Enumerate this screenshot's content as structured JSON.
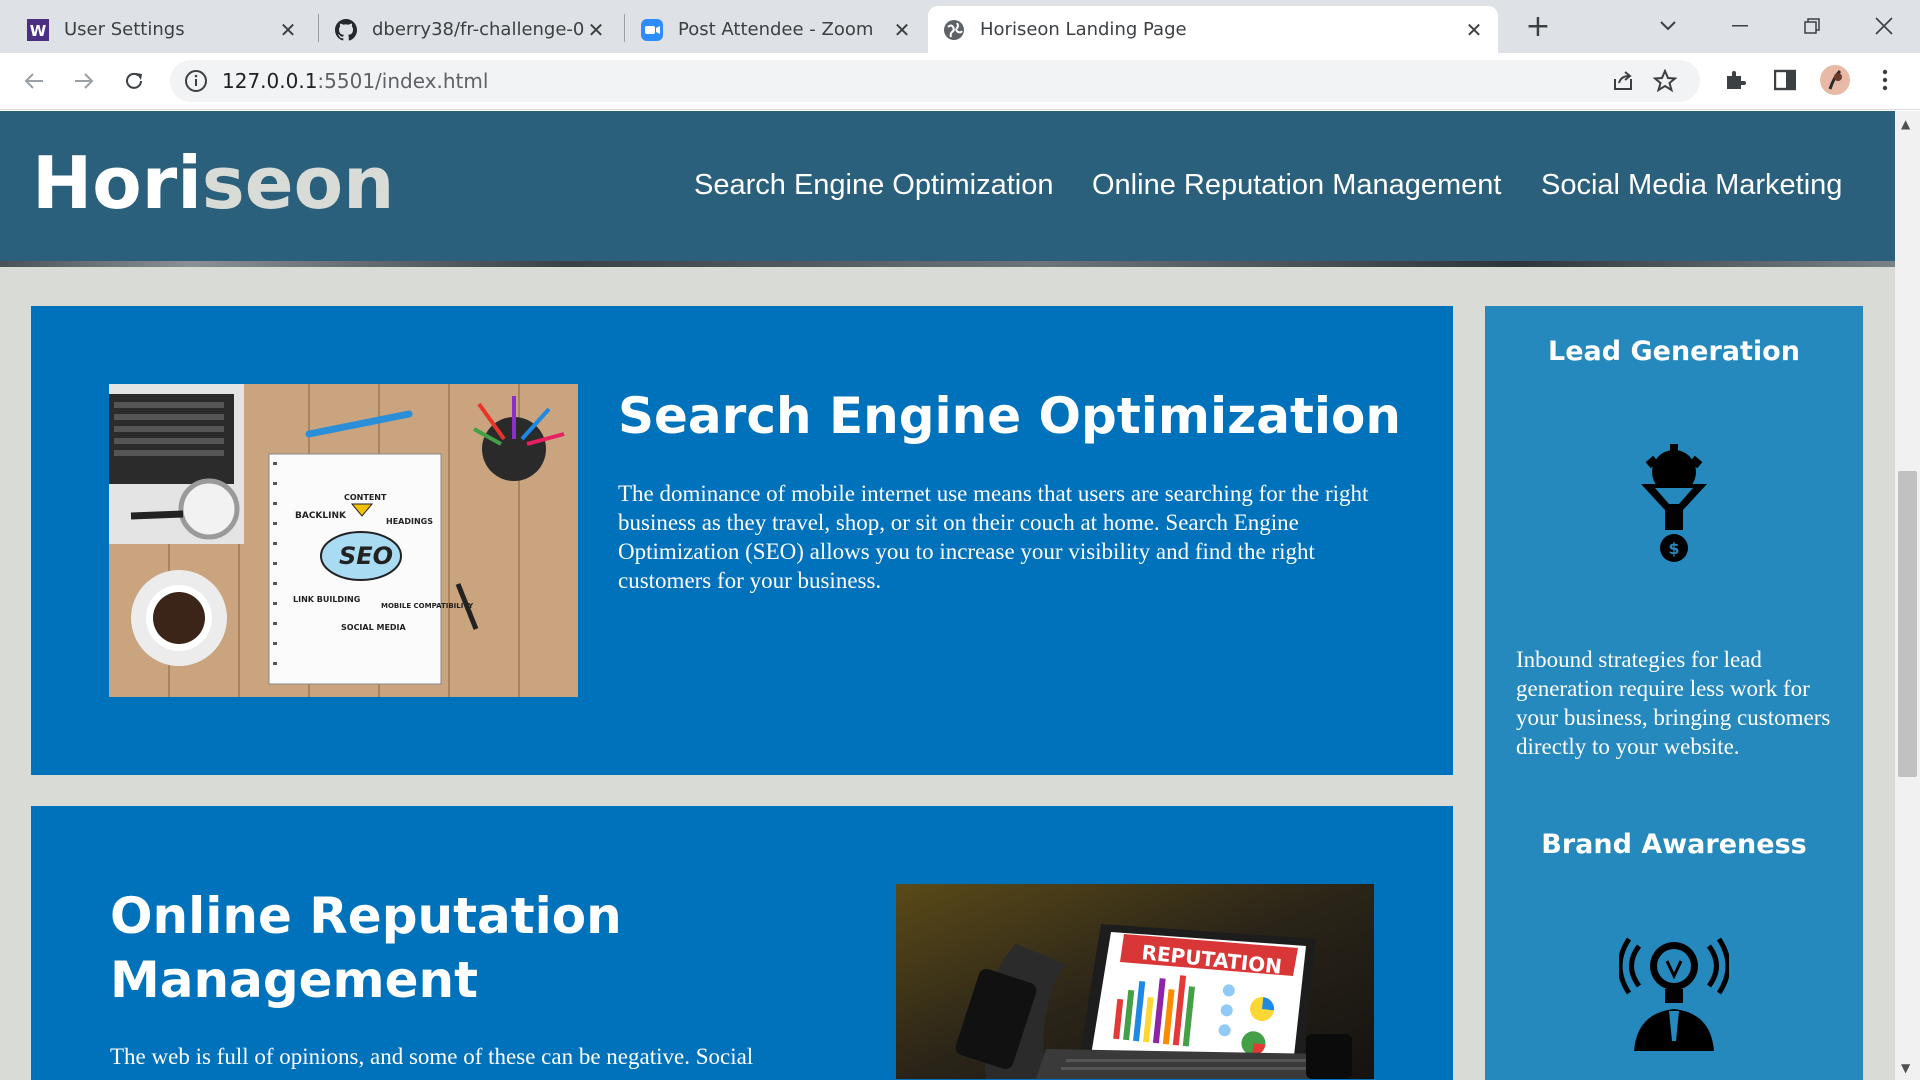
{
  "browser": {
    "tabs": [
      {
        "title": "User Settings",
        "icon": "w-logo-icon"
      },
      {
        "title": "dberry38/fr-challenge-01: Repo f",
        "icon": "github-icon"
      },
      {
        "title": "Post Attendee - Zoom",
        "icon": "zoom-icon"
      },
      {
        "title": "Horiseon Landing Page",
        "icon": "globe-icon"
      }
    ],
    "new_tab": "+",
    "url_host": "127.0.0.1",
    "url_path": ":5501/index.html"
  },
  "site": {
    "logo_main": "Hori",
    "logo_accent": "seon",
    "nav": [
      "Search Engine Optimization",
      "Online Reputation Management",
      "Social Media Marketing"
    ]
  },
  "content": {
    "seo": {
      "title": "Search Engine Optimization",
      "text": "The dominance of mobile internet use means that users are searching for the right business as they travel, shop, or sit on their couch at home. Search Engine Optimization (SEO) allows you to increase your visibility and find the right customers for your business.",
      "image_words": [
        "CONTENT",
        "BACKLINK",
        "HEADINGS",
        "SEO",
        "LINK BUILDING",
        "MOBILE COMPATIBILITY",
        "SOCIAL MEDIA"
      ]
    },
    "orm": {
      "title_line1": "Online Reputation",
      "title_line2": "Management",
      "text": "The web is full of opinions, and some of these can be negative. Social",
      "image_word": "REPUTATION"
    }
  },
  "aside": {
    "lead_title": "Lead Generation",
    "lead_text": "Inbound strategies for lead generation require less work for your business, bringing customers directly to your website.",
    "brand_title": "Brand Awareness"
  },
  "colors": {
    "header": "#2a607c",
    "card": "#0072bb",
    "aside": "#2589bd",
    "page_bg": "#d9dcd6"
  }
}
